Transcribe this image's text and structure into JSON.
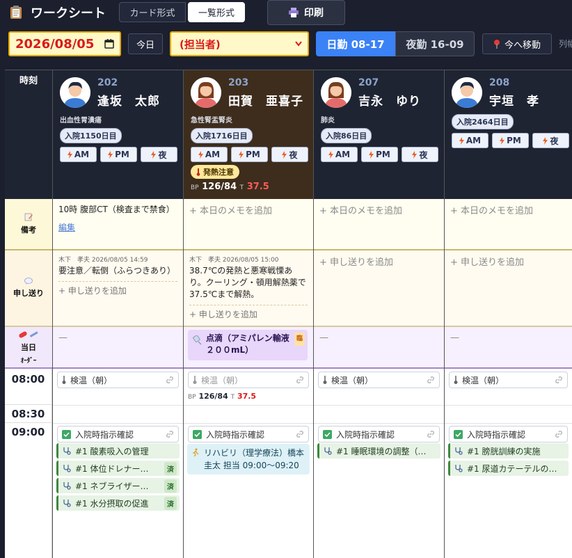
{
  "header": {
    "title": "ワークシート",
    "view_card": "カード形式",
    "view_list": "一覧形式",
    "print": "印刷"
  },
  "controls": {
    "date": "2026/08/05",
    "today": "今日",
    "assignee": "(担当者)",
    "shift_day": "日勤 08-17",
    "shift_night": "夜勤 16-09",
    "move_now": "今へ移動",
    "col_width": "列幅"
  },
  "rows": {
    "time_header": "時刻",
    "memo": "備考",
    "handoff": "申し送り",
    "orders_line1": "当日",
    "orders_line2": "ｵｰﾀﾞｰ",
    "times": [
      "08:00",
      "08:30",
      "09:00"
    ]
  },
  "common": {
    "add_memo": "+ 本日のメモを追加",
    "add_handoff": "+ 申し送りを追加",
    "edit": "編集",
    "slot_am": "AM",
    "slot_pm": "PM",
    "slot_night": "夜",
    "temp_morning": "検温（朝）",
    "admission_orders": "入院時指示確認",
    "done": "済",
    "dash": "—",
    "bp_label": "BP",
    "t_label": "T"
  },
  "patients": [
    {
      "room": "202",
      "name": "逢坂　太郎",
      "diagnosis": "出血性胃潰瘍",
      "days": "入院1150日目",
      "memo": "10時 腹部CT（検査まで禁食）",
      "handoff_meta": "木下　孝夫 2026/08/05 14:59",
      "handoff_text": "要注意／転倒（ふらつきあり）",
      "care": [
        "#1 酸素吸入の管理",
        "#1 体位ドレナー…",
        "#1 ネブライザー…",
        "#1 水分摂取の促進"
      ]
    },
    {
      "room": "203",
      "name": "田賀　亜喜子",
      "diagnosis": "急性腎盂腎炎",
      "days": "入院1716日目",
      "fever": "発熱注意",
      "bp": "126/84",
      "temp": "37.5",
      "handoff_meta": "木下　孝夫 2026/08/05 15:00",
      "handoff_text": "38.7℃の発熱と悪寒戦慄あり。クーリング・頓用解熱薬で37.5℃まで解熱。",
      "order": "点滴（アミパレン輸液　２００mL）",
      "order_badge": "臨",
      "rehab": "リハビリ（理学療法）橋本　圭太 担当 09:00～09:20"
    },
    {
      "room": "207",
      "name": "吉永　ゆり",
      "diagnosis": "肺炎",
      "days": "入院86日目",
      "care": [
        "#1 睡眠環境の調整（…"
      ]
    },
    {
      "room": "208",
      "name": "宇垣　孝",
      "diagnosis": "",
      "days": "入院2464日目",
      "care": [
        "#1 膀胱訓練の実施",
        "#1 尿道カテーテルの…"
      ]
    }
  ]
}
